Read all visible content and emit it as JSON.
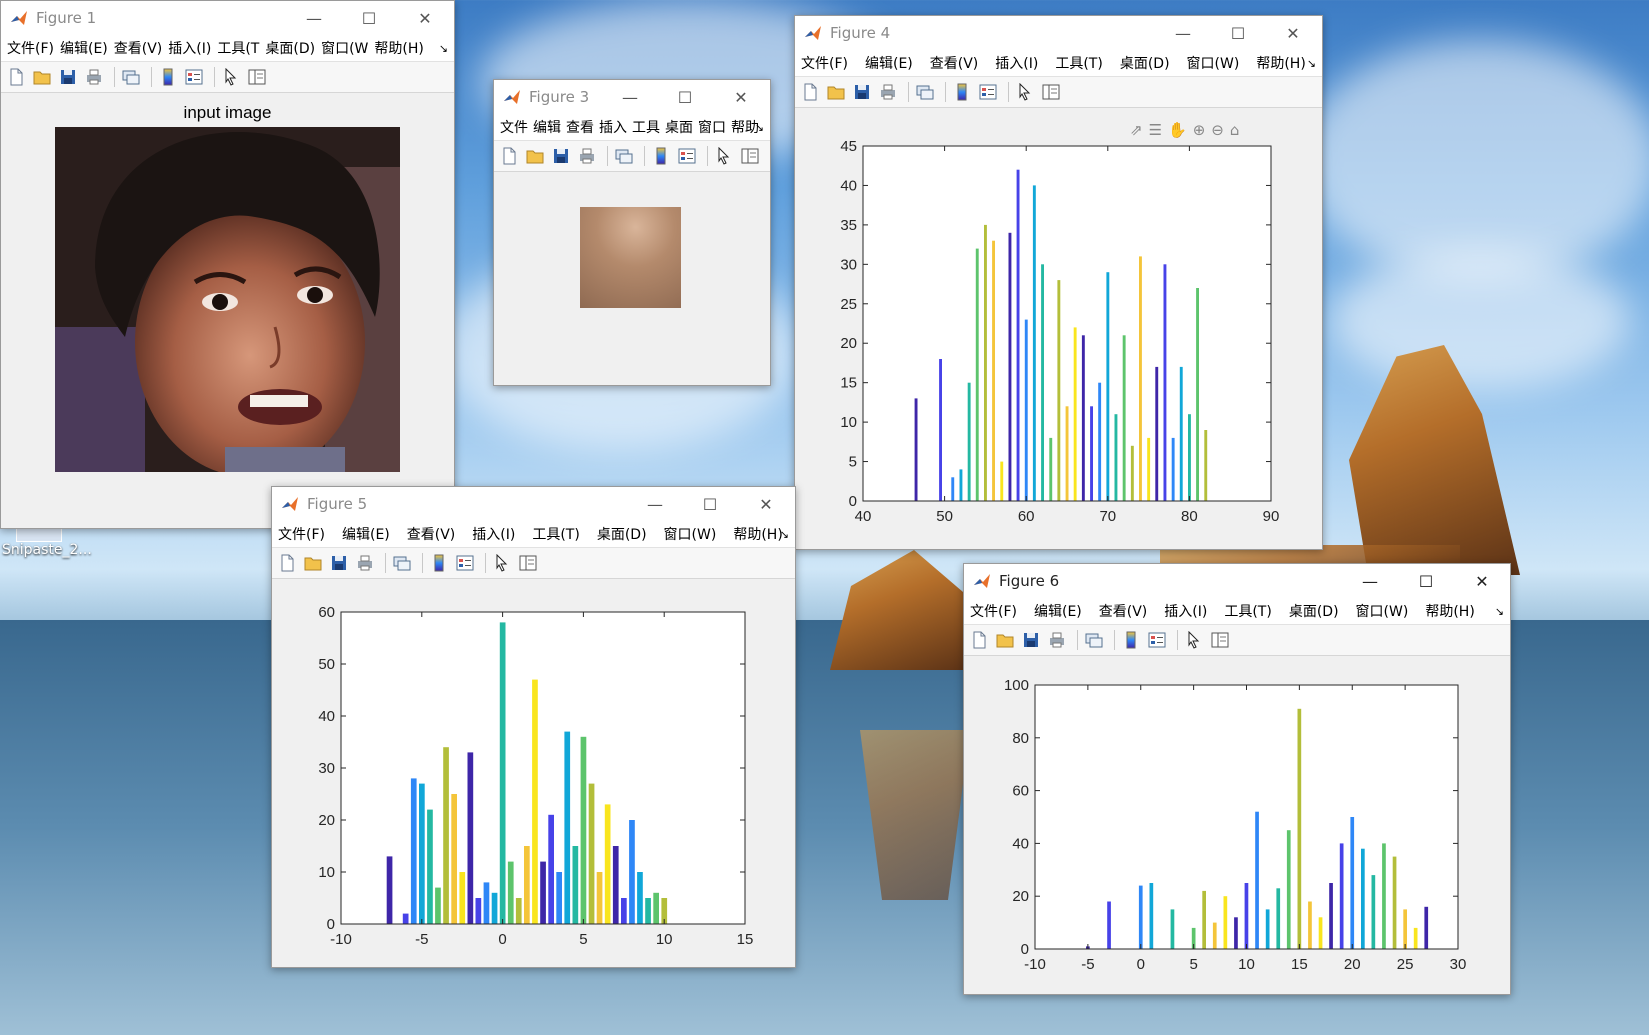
{
  "desktop": {
    "icon_label": "Snipaste_2..."
  },
  "menus": {
    "full": [
      "文件(F)",
      "编辑(E)",
      "查看(V)",
      "插入(I)",
      "工具(T)",
      "桌面(D)",
      "窗口(W)",
      "帮助(H)"
    ],
    "fig1": [
      "文件(F)",
      "编辑(E)",
      "查看(V)",
      "插入(I)",
      "工具(T",
      "桌面(D)",
      "窗口(W",
      "帮助(H)"
    ],
    "fig3": [
      "文件",
      "编辑",
      "查看",
      "插入",
      "工具",
      "桌面",
      "窗口",
      "帮助"
    ]
  },
  "windows": {
    "fig1": {
      "title": "Figure 1",
      "axes_title": "input image"
    },
    "fig3": {
      "title": "Figure 3"
    },
    "fig4": {
      "title": "Figure 4"
    },
    "fig5": {
      "title": "Figure 5"
    },
    "fig6": {
      "title": "Figure 6"
    }
  },
  "colors": {
    "series": [
      "#3e26a8",
      "#4742e8",
      "#2e87f7",
      "#11a7d8",
      "#24b8a2",
      "#5dc46c",
      "#b3be3a",
      "#f4c53a",
      "#f9e51e"
    ]
  },
  "icons": [
    "new-file-icon",
    "open-folder-icon",
    "save-icon",
    "print-icon",
    "link-icon",
    "colorbar-icon",
    "legend-icon",
    "pointer-icon",
    "property-editor-icon"
  ],
  "charts": {
    "fig4": {
      "type": "bar",
      "xlim": [
        40,
        90
      ],
      "ylim": [
        0,
        45
      ],
      "xticks": [
        "40",
        "50",
        "60",
        "70",
        "80",
        "90"
      ],
      "yticks": [
        "0",
        "5",
        "10",
        "15",
        "20",
        "25",
        "30",
        "35",
        "40",
        "45"
      ],
      "x": [
        46.5,
        49.5,
        51,
        52,
        53,
        54,
        55,
        56,
        57,
        58,
        59,
        60,
        61,
        62,
        63,
        64,
        65,
        66,
        67,
        68,
        69,
        70,
        71,
        72,
        73,
        74,
        75,
        76,
        77,
        78,
        79,
        80,
        81,
        82
      ],
      "values": [
        13,
        18,
        3,
        4,
        15,
        32,
        35,
        33,
        5,
        34,
        42,
        23,
        40,
        30,
        8,
        28,
        12,
        22,
        21,
        12,
        15,
        29,
        11,
        21,
        7,
        31,
        8,
        17,
        30,
        8,
        17,
        11,
        27,
        9
      ]
    },
    "fig5": {
      "type": "bar",
      "xlim": [
        -10,
        15
      ],
      "ylim": [
        0,
        60
      ],
      "xticks": [
        "-10",
        "-5",
        "0",
        "5",
        "10",
        "15"
      ],
      "yticks": [
        "0",
        "10",
        "20",
        "30",
        "40",
        "50",
        "60"
      ],
      "x": [
        -7,
        -6,
        -5.5,
        -5,
        -4.5,
        -4,
        -3.5,
        -3,
        -2.5,
        -2,
        -1.5,
        -1,
        -0.5,
        0,
        0.5,
        1,
        1.5,
        2,
        2.5,
        3,
        3.5,
        4,
        4.5,
        5,
        5.5,
        6,
        6.5,
        7,
        7.5,
        8,
        8.5,
        9,
        9.5,
        10
      ],
      "values": [
        13,
        2,
        28,
        27,
        22,
        7,
        34,
        25,
        10,
        33,
        5,
        8,
        6,
        58,
        12,
        5,
        15,
        47,
        12,
        21,
        10,
        37,
        15,
        36,
        27,
        10,
        23,
        15,
        5,
        20,
        10,
        5,
        6,
        5
      ]
    },
    "fig6": {
      "type": "bar",
      "xlim": [
        -10,
        30
      ],
      "ylim": [
        0,
        100
      ],
      "xticks": [
        "-10",
        "-5",
        "0",
        "5",
        "10",
        "15",
        "20",
        "25",
        "30"
      ],
      "yticks": [
        "0",
        "20",
        "40",
        "60",
        "80",
        "100"
      ],
      "x": [
        -5,
        -3,
        0,
        1,
        3,
        5,
        6,
        7,
        8,
        9,
        10,
        11,
        12,
        13,
        14,
        15,
        16,
        17,
        18,
        19,
        20,
        21,
        22,
        23,
        24,
        25,
        26,
        27
      ],
      "values": [
        1,
        18,
        24,
        25,
        15,
        8,
        22,
        10,
        20,
        12,
        25,
        52,
        15,
        23,
        45,
        91,
        18,
        12,
        25,
        40,
        50,
        38,
        28,
        40,
        35,
        15,
        8,
        16
      ]
    }
  }
}
